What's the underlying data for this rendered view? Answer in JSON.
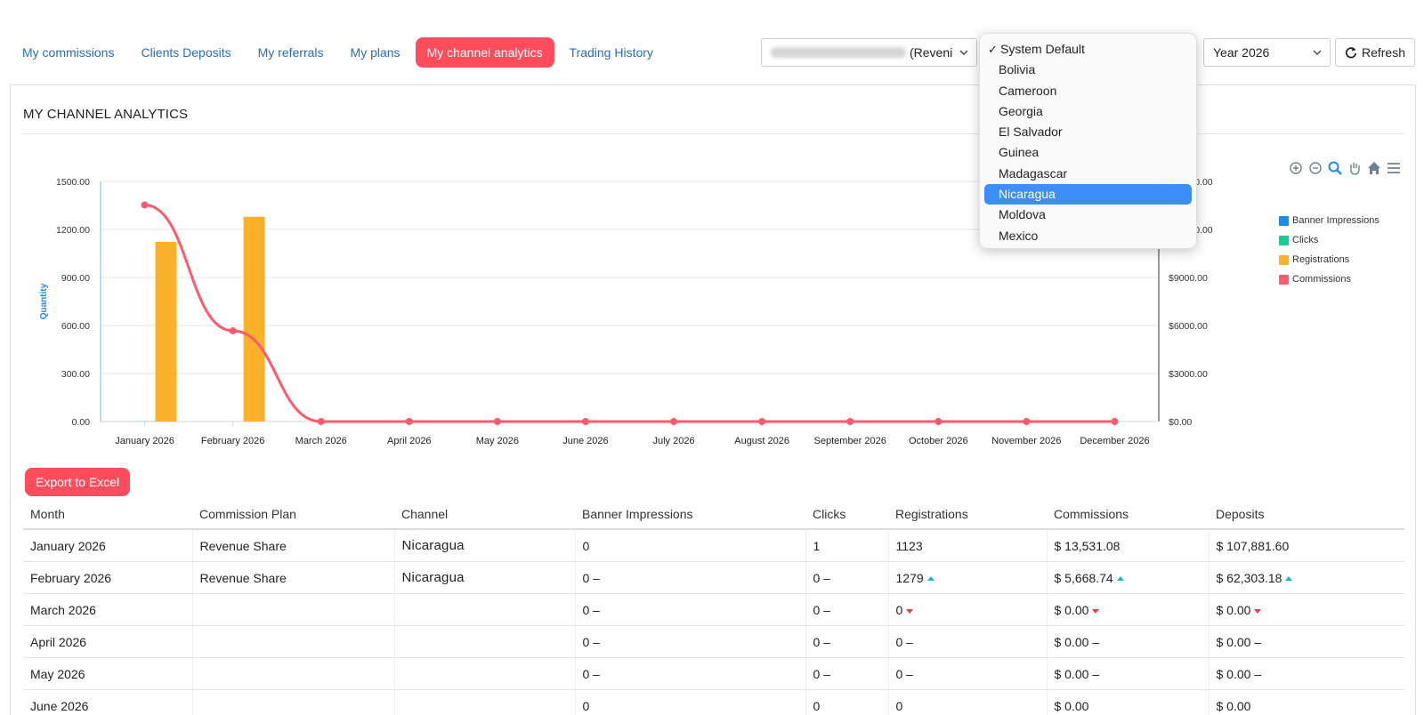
{
  "nav": {
    "tabs": [
      {
        "label": "My commissions"
      },
      {
        "label": "Clients Deposits"
      },
      {
        "label": "My referrals"
      },
      {
        "label": "My plans"
      },
      {
        "label": "My channel analytics",
        "active": true
      },
      {
        "label": "Trading History"
      }
    ]
  },
  "filters": {
    "account_suffix": "(Reveni",
    "year": "Year 2026",
    "refresh_label": "Refresh"
  },
  "country_dropdown": {
    "selected": "System Default",
    "highlighted": "Nicaragua",
    "options": [
      "System Default",
      "Bolivia",
      "Cameroon",
      "Georgia",
      "El Salvador",
      "Guinea",
      "Madagascar",
      "Nicaragua",
      "Moldova",
      "Mexico"
    ]
  },
  "panel": {
    "title": "MY CHANNEL ANALYTICS"
  },
  "chart_data": {
    "type": "bar",
    "categories": [
      "January 2026",
      "February 2026",
      "March 2026",
      "April 2026",
      "May 2026",
      "June 2026",
      "July 2026",
      "August 2026",
      "September 2026",
      "October 2026",
      "November 2026",
      "December 2026"
    ],
    "ylabel": "Quantity",
    "ylim": [
      0,
      1500
    ],
    "y_ticks": [
      "0.00",
      "300.00",
      "600.00",
      "900.00",
      "1200.00",
      "1500.00"
    ],
    "y2lim": [
      0,
      15000
    ],
    "y2_ticks": [
      "$0.00",
      "$3000.00",
      "$6000.00",
      "$9000.00",
      "$12000.00",
      "$15000.00"
    ],
    "legend_position": "right",
    "series": [
      {
        "name": "Banner Impressions",
        "type": "bar",
        "axis": "left",
        "color": "#1a8cf0",
        "values": [
          0,
          0,
          0,
          0,
          0,
          0,
          0,
          0,
          0,
          0,
          0,
          0
        ]
      },
      {
        "name": "Clicks",
        "type": "bar",
        "axis": "left",
        "color": "#10d48e",
        "values": [
          1,
          0,
          0,
          0,
          0,
          0,
          0,
          0,
          0,
          0,
          0,
          0
        ]
      },
      {
        "name": "Registrations",
        "type": "bar",
        "axis": "left",
        "color": "#fbb22a",
        "values": [
          1123,
          1279,
          0,
          0,
          0,
          0,
          0,
          0,
          0,
          0,
          0,
          0
        ]
      },
      {
        "name": "Commissions",
        "type": "line",
        "axis": "right",
        "color": "#fe5a6e",
        "values": [
          13531.08,
          5668.74,
          0,
          0,
          0,
          0,
          0,
          0,
          0,
          0,
          0,
          0
        ]
      }
    ]
  },
  "export_label": "Export to Excel",
  "table": {
    "headers": [
      "Month",
      "Commission Plan",
      "Channel",
      "Banner Impressions",
      "Clicks",
      "Registrations",
      "Commissions",
      "Deposits"
    ],
    "rows": [
      {
        "month": "January 2026",
        "plan": "Revenue Share",
        "channel": "Nicaragua",
        "impressions": "0",
        "clicks": "1",
        "registrations": "1123",
        "commissions": "$ 13,531.08",
        "deposits": "$ 107,881.60",
        "ti": "",
        "tc": "",
        "tr": "",
        "tm": "",
        "td": ""
      },
      {
        "month": "February 2026",
        "plan": "Revenue Share",
        "channel": "Nicaragua",
        "impressions": "0 –",
        "clicks": "0 –",
        "registrations": "1279",
        "commissions": "$ 5,668.74",
        "deposits": "$ 62,303.18",
        "ti": "",
        "tc": "",
        "tr": "up",
        "tm": "up",
        "td": "up"
      },
      {
        "month": "March 2026",
        "plan": "",
        "channel": "",
        "impressions": "0 –",
        "clicks": "0 –",
        "registrations": "0",
        "commissions": "$ 0.00",
        "deposits": "$ 0.00",
        "ti": "",
        "tc": "",
        "tr": "down",
        "tm": "down",
        "td": "down"
      },
      {
        "month": "April 2026",
        "plan": "",
        "channel": "",
        "impressions": "0 –",
        "clicks": "0 –",
        "registrations": "0 –",
        "commissions": "$ 0.00 –",
        "deposits": "$ 0.00 –",
        "ti": "",
        "tc": "",
        "tr": "",
        "tm": "",
        "td": ""
      },
      {
        "month": "May 2026",
        "plan": "",
        "channel": "",
        "impressions": "0 –",
        "clicks": "0 –",
        "registrations": "0 –",
        "commissions": "$ 0.00 –",
        "deposits": "$ 0.00 –",
        "ti": "",
        "tc": "",
        "tr": "",
        "tm": "",
        "td": ""
      },
      {
        "month": "June 2026",
        "plan": "",
        "channel": "",
        "impressions": "0",
        "clicks": "0",
        "registrations": "0",
        "commissions": "$ 0.00",
        "deposits": "$ 0.00",
        "ti": "",
        "tc": "",
        "tr": "",
        "tm": "",
        "td": ""
      }
    ]
  }
}
